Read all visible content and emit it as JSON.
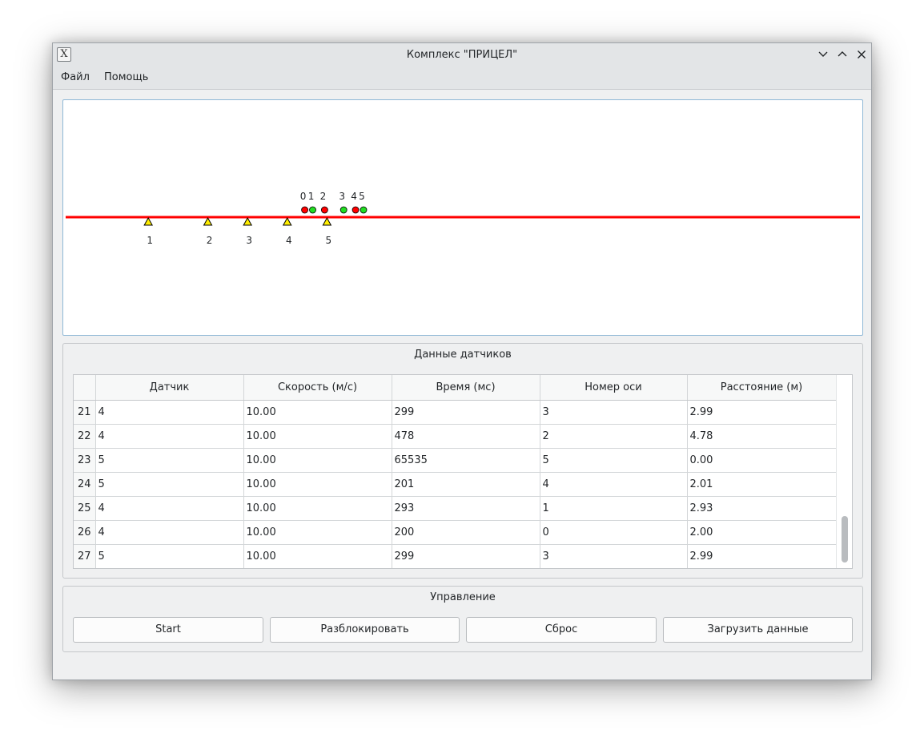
{
  "window": {
    "title": "Комплекс \"ПРИЦЕЛ\"",
    "app_icon_glyph": "X"
  },
  "menu": {
    "file": "Файл",
    "help": "Помощь"
  },
  "scene": {
    "track_color": "#ff0000",
    "sensors": [
      {
        "label": "1",
        "track_pos": 0.104
      },
      {
        "label": "2",
        "track_pos": 0.179
      },
      {
        "label": "3",
        "track_pos": 0.229
      },
      {
        "label": "4",
        "track_pos": 0.279
      },
      {
        "label": "5",
        "track_pos": 0.329
      }
    ],
    "axles": [
      {
        "label": "0",
        "state": "red",
        "track_pos": 0.301
      },
      {
        "label": "1",
        "state": "green",
        "track_pos": 0.311
      },
      {
        "label": "2",
        "state": "red",
        "track_pos": 0.326
      },
      {
        "label": "3",
        "state": "green",
        "track_pos": 0.35
      },
      {
        "label": "4",
        "state": "red",
        "track_pos": 0.365
      },
      {
        "label": "5",
        "state": "green",
        "track_pos": 0.375
      }
    ],
    "colors": {
      "red": "#ff0000",
      "green": "#22dd22",
      "triangle": "#ffee00"
    }
  },
  "sensors_group": {
    "title": "Данные датчиков",
    "columns": [
      "Датчик",
      "Скорость (м/с)",
      "Время (мс)",
      "Номер оси",
      "Расстояние (м)"
    ],
    "rows": [
      {
        "n": "21",
        "cells": [
          "4",
          "10.00",
          "299",
          "3",
          "2.99"
        ]
      },
      {
        "n": "22",
        "cells": [
          "4",
          "10.00",
          "478",
          "2",
          "4.78"
        ]
      },
      {
        "n": "23",
        "cells": [
          "5",
          "10.00",
          "65535",
          "5",
          "0.00"
        ]
      },
      {
        "n": "24",
        "cells": [
          "5",
          "10.00",
          "201",
          "4",
          "2.01"
        ]
      },
      {
        "n": "25",
        "cells": [
          "4",
          "10.00",
          "293",
          "1",
          "2.93"
        ]
      },
      {
        "n": "26",
        "cells": [
          "4",
          "10.00",
          "200",
          "0",
          "2.00"
        ]
      },
      {
        "n": "27",
        "cells": [
          "5",
          "10.00",
          "299",
          "3",
          "2.99"
        ]
      }
    ]
  },
  "control_group": {
    "title": "Управление",
    "start": "Start",
    "unlock": "Разблокировать",
    "reset": "Сброс",
    "load": "Загрузить данные"
  }
}
